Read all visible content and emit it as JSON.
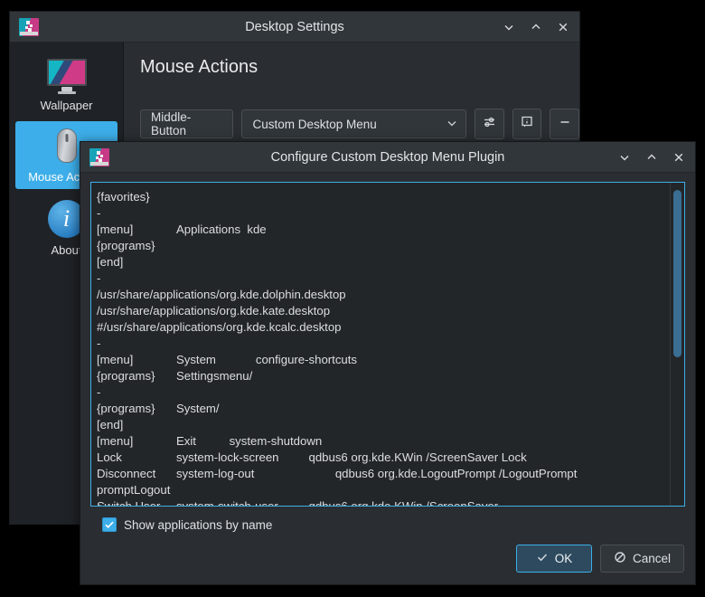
{
  "main_window": {
    "title": "Desktop Settings",
    "icon": "desktop-settings-icon",
    "window_buttons": {
      "minimize": "minimize-icon",
      "maximize": "maximize-icon",
      "close": "close-icon"
    },
    "sidebar": {
      "items": [
        {
          "label": "Wallpaper",
          "icon": "monitor-wallpaper-icon",
          "selected": false
        },
        {
          "label": "Mouse Actions",
          "icon": "mouse-icon",
          "selected": true
        },
        {
          "label": "About",
          "icon": "info-circle-icon",
          "selected": false
        }
      ]
    },
    "content": {
      "page_title": "Mouse Actions",
      "rows": [
        {
          "trigger_label": "Middle-Button",
          "action_value": "Custom Desktop Menu",
          "configure_icon": "sliders-icon",
          "info_icon": "info-box-icon",
          "remove_icon": "minus-icon"
        }
      ]
    }
  },
  "dialog": {
    "title": "Configure Custom Desktop Menu Plugin",
    "icon": "desktop-settings-icon",
    "window_buttons": {
      "minimize": "minimize-icon",
      "maximize": "maximize-icon",
      "close": "close-icon"
    },
    "editor": {
      "content": "{favorites}\n-\n[menu]\t\tApplications  kde\n{programs}\n[end]\n-\n/usr/share/applications/org.kde.dolphin.desktop\n/usr/share/applications/org.kde.kate.desktop\n#/usr/share/applications/org.kde.kcalc.desktop\n-\n[menu]\t\tSystem\t\tconfigure-shortcuts\n{programs}\tSettingsmenu/\n-\n{programs}\tSystem/\n[end]\n[menu]\t\tExit\t\tsystem-shutdown\nLock\t\tsystem-lock-screen\t\tqdbus6 org.kde.KWin /ScreenSaver Lock\nDisconnect\tsystem-log-out\t\t\tqdbus6 org.kde.LogoutPrompt /LogoutPrompt\npromptLogout\nSwitch User\tsystem-switch-user\t\tqdbus6 org.kde.KWin /ScreenSaver",
      "scrollbar": "vertical-scrollbar"
    },
    "checkbox": {
      "label": "Show applications by name",
      "checked": true
    },
    "buttons": {
      "ok": "OK",
      "cancel": "Cancel",
      "ok_icon": "check-icon",
      "cancel_icon": "cancel-circle-icon"
    }
  },
  "colors": {
    "accent": "#3daee9",
    "window_bg": "#2a2e32",
    "titlebar_bg": "#31363b",
    "editor_bg": "#232629",
    "sidebar_bg": "#1f2226"
  }
}
